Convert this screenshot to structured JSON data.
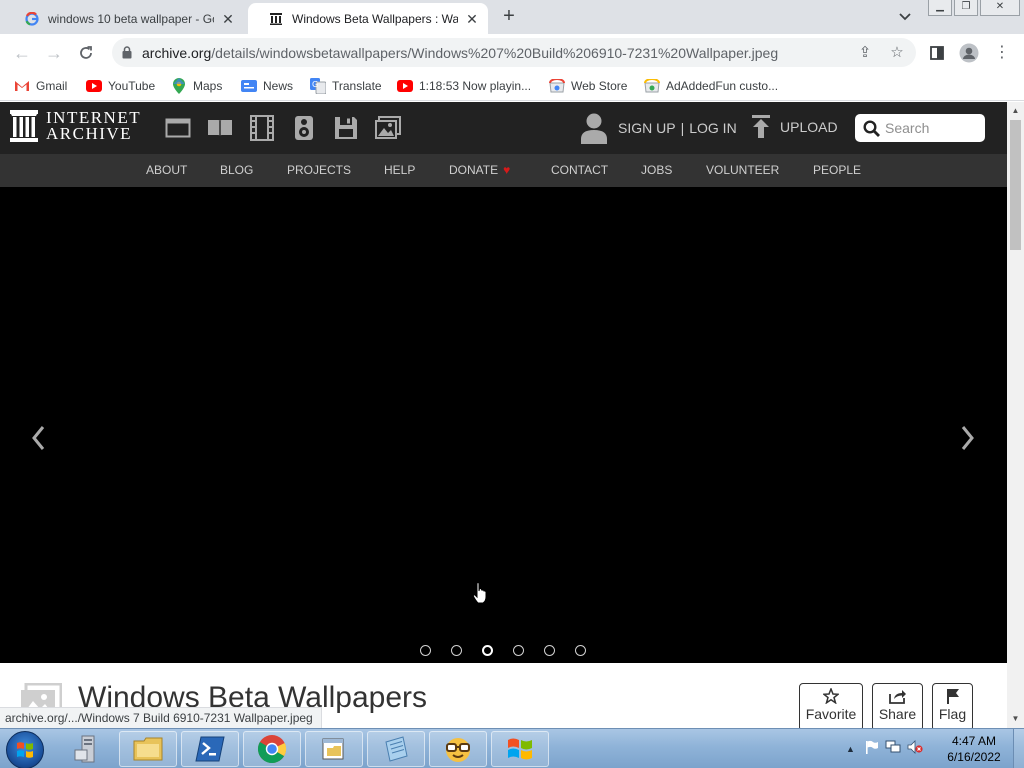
{
  "browser": {
    "tabs": [
      {
        "title": "windows 10 beta wallpaper - Goo",
        "favicon": "google-icon",
        "active": false
      },
      {
        "title": "Windows Beta Wallpapers : Wall",
        "favicon": "internet-archive-icon",
        "active": true
      }
    ],
    "new_tab_label": "+",
    "address": {
      "host": "archive.org",
      "path": "/details/windowsbetawallpapers/Windows%207%20Build%206910-7231%20Wallpaper.jpeg"
    },
    "bookmarks": [
      {
        "label": "Gmail",
        "icon": "gmail-icon"
      },
      {
        "label": "YouTube",
        "icon": "youtube-icon"
      },
      {
        "label": "Maps",
        "icon": "maps-icon"
      },
      {
        "label": "News",
        "icon": "news-icon"
      },
      {
        "label": "Translate",
        "icon": "translate-icon"
      },
      {
        "label": "1:18:53 Now playin...",
        "icon": "youtube-icon"
      },
      {
        "label": "Web Store",
        "icon": "web-store-icon"
      },
      {
        "label": "AdAddedFun custo...",
        "icon": "addon-icon"
      }
    ],
    "status_url": "archive.org/.../Windows 7 Build 6910-7231 Wallpaper.jpeg"
  },
  "ia": {
    "logo_line1": "INTERNET",
    "logo_line2": "ARCHIVE",
    "media_icons": [
      "web-icon",
      "texts-icon",
      "video-icon",
      "audio-icon",
      "software-icon",
      "images-icon"
    ],
    "sign_up": "SIGN UP",
    "separator": "|",
    "log_in": "LOG IN",
    "upload": "UPLOAD",
    "search_placeholder": "Search",
    "nav": [
      "ABOUT",
      "BLOG",
      "PROJECTS",
      "HELP",
      "DONATE",
      "CONTACT",
      "JOBS",
      "VOLUNTEER",
      "PEOPLE"
    ],
    "carousel": {
      "slide_count": 6,
      "active_index": 2
    },
    "item_title": "Windows Beta Wallpapers",
    "actions": [
      {
        "label": "Favorite",
        "icon": "star-icon"
      },
      {
        "label": "Share",
        "icon": "share-icon"
      },
      {
        "label": "Flag",
        "icon": "flag-icon"
      }
    ]
  },
  "taskbar": {
    "apps": [
      "server-manager-icon",
      "file-explorer-icon",
      "powershell-icon",
      "chrome-icon",
      "folder-window-icon",
      "notepad-icon",
      "nerd-face-icon",
      "windows-flag-icon"
    ],
    "clock_time": "4:47 AM",
    "clock_date": "6/16/2022"
  },
  "colors": {
    "ia_header": "#222222",
    "ia_nav": "#333333",
    "carousel_bg": "#000000",
    "donate_heart": "#d61a1a"
  }
}
